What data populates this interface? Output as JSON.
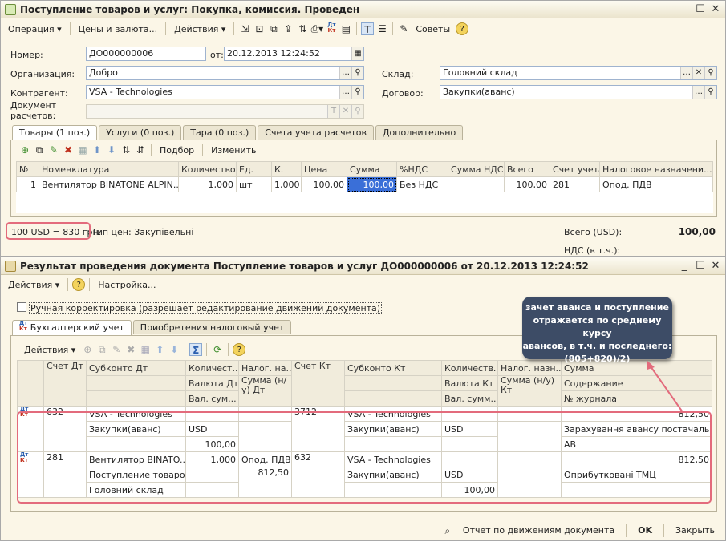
{
  "top": {
    "title": "Поступление товаров и услуг: Покупка, комиссия. Проведен",
    "toolbar": {
      "operation": "Операция",
      "prices": "Цены и валюта...",
      "actions": "Действия",
      "tips": "Советы"
    },
    "number_label": "Номер:",
    "number_value": "ДО000000006",
    "date_label": "от:",
    "date_value": "20.12.2013 12:24:52",
    "org_label": "Организация:",
    "org_value": "Добро",
    "warehouse_label": "Склад:",
    "warehouse_value": "Головний склад",
    "counterparty_label": "Контрагент:",
    "counterparty_value": "VSA - Technologies",
    "contract_label": "Договор:",
    "contract_value": "Закупки(аванс)",
    "docset_label_1": "Документ",
    "docset_label_2": "расчетов:",
    "tabs": [
      "Товары (1 поз.)",
      "Услуги (0 поз.)",
      "Тара (0 поз.)",
      "Счета учета расчетов",
      "Дополнительно"
    ],
    "grid_toolbar": {
      "pick": "Подбор",
      "change": "Изменить"
    },
    "columns": [
      "№",
      "Номенклатура",
      "Количество",
      "Ед.",
      "К.",
      "Цена",
      "Сумма",
      "%НДС",
      "Сумма НДС",
      "Всего",
      "Счет учета",
      "Налоговое назначени..."
    ],
    "row": [
      "1",
      "Вентилятор BINATONE ALPIN...",
      "1,000",
      "шт",
      "1,000",
      "100,00",
      "100,00",
      "Без НДС",
      "",
      "100,00",
      "281",
      "Опод. ПДВ"
    ],
    "rate_text": "100 USD = 830 грн.",
    "price_type": "Тип цен: Закупівельні",
    "total_label": "Всего (USD):",
    "total_value": "100,00",
    "vat_label": "НДС (в т.ч.):"
  },
  "bottom": {
    "title": "Результат проведения документа Поступление товаров и услуг ДО000000006 от 20.12.2013 12:24:52",
    "actions": "Действия",
    "settings": "Настройка...",
    "manual_check": "Ручная корректировка (разрешает редактирование движений документа)",
    "tabs": [
      "Бухгалтерский учет",
      "Приобретения налоговый учет"
    ],
    "grid_actions": "Действия",
    "head1": [
      "Счет Дт",
      "Субконто Дт",
      "Количест...",
      "Налог. на...",
      "Счет Кт",
      "Субконто Кт",
      "Количеств...",
      "Налог. назн...",
      "Сумма"
    ],
    "head2": [
      "Валюта Дт",
      "Сумма (н/у) Дт",
      "Валюта Кт",
      "Сумма (н/у) Кт",
      "Содержание"
    ],
    "head3": [
      "Вал. сум...",
      "Вал. сумм...",
      "№ журнала"
    ],
    "rec1": {
      "acc_dt": "632",
      "sub_dt_1": "VSA - Technologies",
      "sub_dt_2": "Закупки(аванс)",
      "cur_dt": "USD",
      "val_dt": "100,00",
      "acc_kt": "3712",
      "sub_kt_1": "VSA - Technologies",
      "sub_kt_2": "Закупки(аванс)",
      "cur_kt": "USD",
      "sum": "812,50",
      "content": "Зарахування авансу постачальн...",
      "journal": "АВ"
    },
    "rec2": {
      "acc_dt": "281",
      "sub_dt_1": "Вентилятор BINATO...",
      "sub_dt_2": "Поступление товаро...",
      "sub_dt_3": "Головний склад",
      "qty_dt": "1,000",
      "tax_dt": "Опод. ПДВ",
      "sum_nu_dt": "812,50",
      "acc_kt": "632",
      "sub_kt_1": "VSA - Technologies",
      "sub_kt_2": "Закупки(аванс)",
      "cur_kt": "USD",
      "val_kt": "100,00",
      "sum": "812,50",
      "content": "Оприбутковані ТМЦ"
    },
    "callout": [
      "зачет аванса и поступление",
      "отражается по среднему курсу",
      "авансов, в т.ч. и последнего:",
      "(805+820)/2)"
    ],
    "footer": {
      "report": "Отчет по движениям документа",
      "ok": "OK",
      "close": "Закрыть"
    }
  },
  "colors": {
    "highlight_red": "#e36b7c",
    "callout_bg": "#3d4c66",
    "selected_cell": "#3a6fd8"
  }
}
